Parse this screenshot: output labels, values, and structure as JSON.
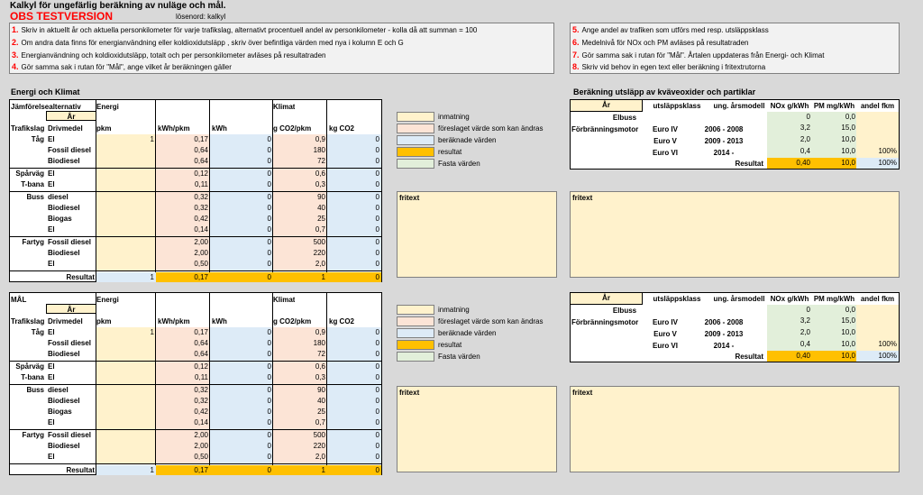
{
  "header": {
    "title": "Kalkyl för ungefärlig beräkning av nuläge och mål.",
    "obs": "OBS TESTVERSION",
    "password": "lösenord:  kalkyl"
  },
  "instructions_left": [
    {
      "num": "1.",
      "text": "Skriv in aktuellt år och aktuella personkilometer för varje trafikslag, alternativt procentuell andel av personkilometer - kolla då att summan = 100"
    },
    {
      "num": "2.",
      "text": "Om andra data finns för energianvändning eller koldioxidutsläpp , skriv över befintliga värden med nya i kolumn E och G"
    },
    {
      "num": "3.",
      "text": "Energianvändning och koldioxidutsläpp, totalt och per personkilometer avläses på resultatraden"
    },
    {
      "num": "4.",
      "text": "Gör samma sak i rutan för \"Mål\", ange vilket år beräkningen gäller"
    }
  ],
  "instructions_right": [
    {
      "num": "5.",
      "text": "Ange andel av trafiken som utförs med resp. utsläppsklass"
    },
    {
      "num": "6.",
      "text": "Medelnivå för NOx och PM avläses på resultatraden"
    },
    {
      "num": "7.",
      "text": "Gör samma sak i rutan för \"Mål\". Årtalen uppdateras från Energi- och Klimat"
    },
    {
      "num": "8.",
      "text": "Skriv vid behov in egen text eller beräkning i fritextrutorna"
    }
  ],
  "section_energy_title": "Energi och Klimat",
  "section_emissions_title": "Beräkning utsläpp av kväveoxider och partiklar",
  "table1": {
    "corner": "Jämförelsealternativ",
    "ar": "År",
    "energi": "Energi",
    "klimat": "Klimat"
  },
  "table2": {
    "corner": "MÅL",
    "ar": "År",
    "energi": "Energi",
    "klimat": "Klimat"
  },
  "cols": {
    "trafikslag": "Trafikslag",
    "drivmedel": "Drivmedel",
    "pkm": "pkm",
    "kwhpkm": "kWh/pkm",
    "kwh": "kWh",
    "gco2": "g CO2/pkm",
    "kgco2": "kg CO2"
  },
  "rows": [
    {
      "t": "Tåg",
      "d": "El",
      "pkm": "1",
      "kwhpkm": "0,17",
      "kwh": "0",
      "g": "0,9",
      "kg": "0"
    },
    {
      "t": "",
      "d": "Fossil diesel",
      "pkm": "",
      "kwhpkm": "0,64",
      "kwh": "0",
      "g": "180",
      "kg": "0"
    },
    {
      "t": "",
      "d": "Biodiesel",
      "pkm": "",
      "kwhpkm": "0,64",
      "kwh": "0",
      "g": "72",
      "kg": "0"
    },
    {
      "t": "Spårväg",
      "d": "El",
      "pkm": "",
      "kwhpkm": "0,12",
      "kwh": "0",
      "g": "0,6",
      "kg": "0"
    },
    {
      "t": "T-bana",
      "d": "El",
      "pkm": "",
      "kwhpkm": "0,11",
      "kwh": "0",
      "g": "0,3",
      "kg": "0"
    },
    {
      "t": "Buss",
      "d": "diesel",
      "pkm": "",
      "kwhpkm": "0,32",
      "kwh": "0",
      "g": "90",
      "kg": "0"
    },
    {
      "t": "",
      "d": "Biodiesel",
      "pkm": "",
      "kwhpkm": "0,32",
      "kwh": "0",
      "g": "40",
      "kg": "0"
    },
    {
      "t": "",
      "d": "Biogas",
      "pkm": "",
      "kwhpkm": "0,42",
      "kwh": "0",
      "g": "25",
      "kg": "0"
    },
    {
      "t": "",
      "d": "El",
      "pkm": "",
      "kwhpkm": "0,14",
      "kwh": "0",
      "g": "0,7",
      "kg": "0"
    },
    {
      "t": "Fartyg",
      "d": "Fossil diesel",
      "pkm": "",
      "kwhpkm": "2,00",
      "kwh": "0",
      "g": "500",
      "kg": "0"
    },
    {
      "t": "",
      "d": "Biodiesel",
      "pkm": "",
      "kwhpkm": "2,00",
      "kwh": "0",
      "g": "220",
      "kg": "0"
    },
    {
      "t": "",
      "d": "El",
      "pkm": "",
      "kwhpkm": "0,50",
      "kwh": "0",
      "g": "2,0",
      "kg": "0"
    }
  ],
  "result": {
    "label": "Resultat",
    "pkm": "1",
    "kwhpkm": "0,17",
    "kwh": "0",
    "g": "1",
    "kg": "0"
  },
  "legend": [
    "inmatning",
    "föreslaget värde som kan ändras",
    "beräknade värden",
    "resultat",
    "Fasta värden"
  ],
  "fritext": "fritext",
  "emis": {
    "ar": "År",
    "cols": [
      "utsläppsklass",
      "ung. årsmodell",
      "NOx g/kWh",
      "PM mg/kWh",
      "andel fkm"
    ],
    "elbuss": {
      "name": "Elbuss",
      "nox": "0",
      "pm": "0,0"
    },
    "motor": "Förbränningsmotor",
    "classes": [
      {
        "cls": "Euro IV",
        "yr": "2006 - 2008",
        "nox": "3,2",
        "pm": "15,0",
        "andel": ""
      },
      {
        "cls": "Euro V",
        "yr": "2009 - 2013",
        "nox": "2,0",
        "pm": "10,0",
        "andel": ""
      },
      {
        "cls": "Euro VI",
        "yr": "2014 -",
        "nox": "0,4",
        "pm": "10,0",
        "andel": "100%"
      }
    ],
    "result": {
      "label": "Resultat",
      "nox": "0,40",
      "pm": "10,0",
      "andel": "100%"
    }
  }
}
